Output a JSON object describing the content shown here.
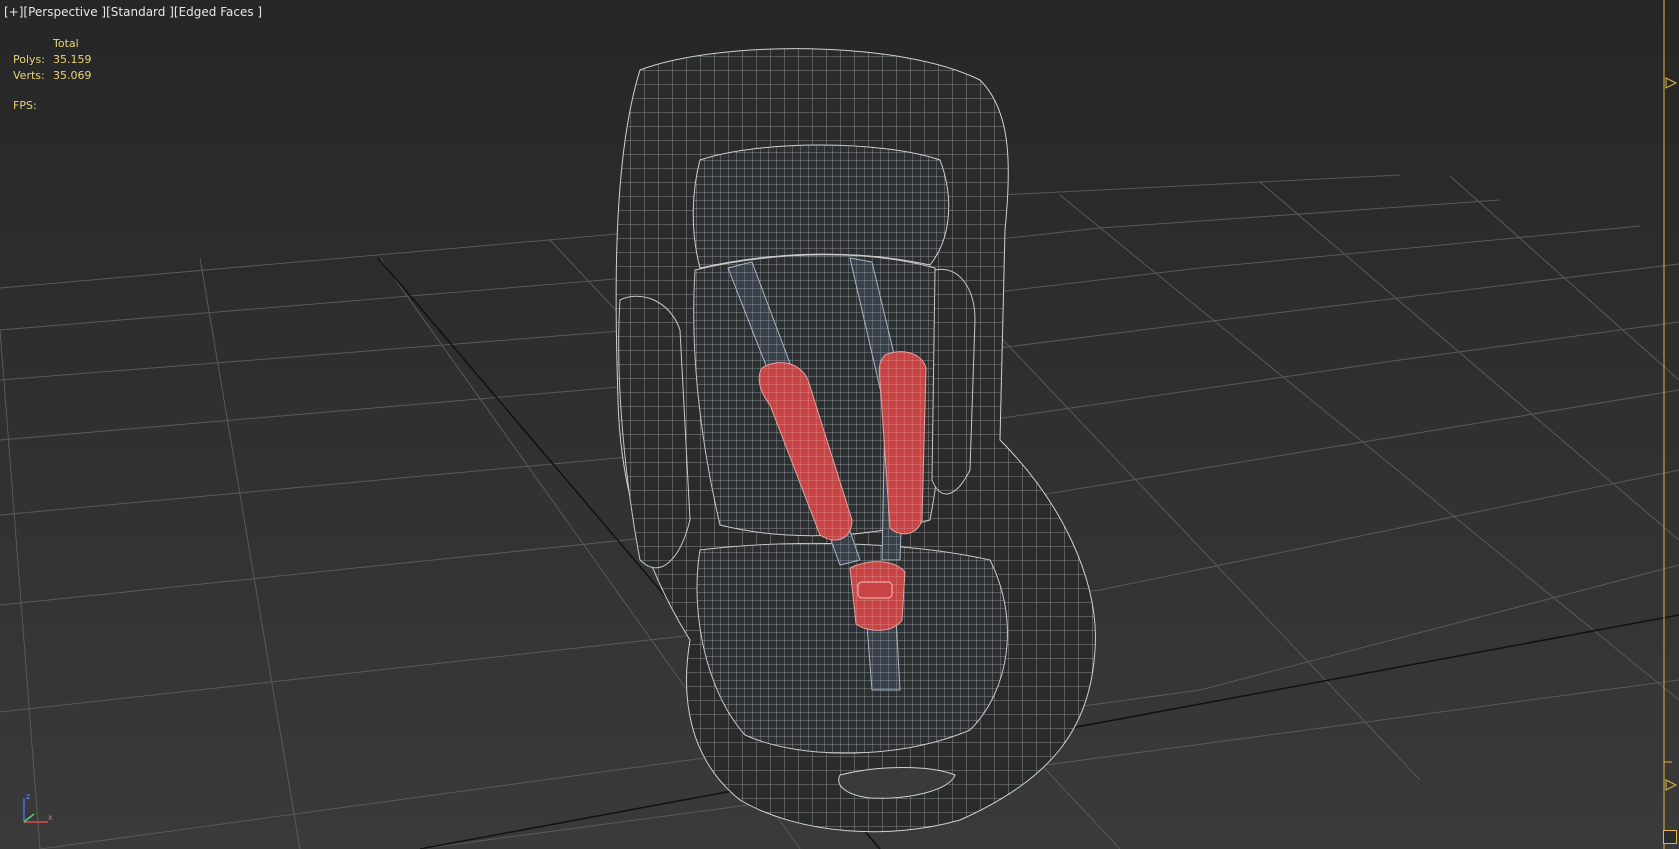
{
  "viewport": {
    "label_plus": "[+]",
    "label_view": "[Perspective ]",
    "label_shading": "[Standard ]",
    "label_mode": "[Edged Faces ]"
  },
  "stats": {
    "header": "Total",
    "polys_label": "Polys:",
    "polys_value": "35.159",
    "verts_label": "Verts:",
    "verts_value": "35.069",
    "fps_label": "FPS:"
  },
  "axis": {
    "z": "z",
    "x": "x"
  },
  "colors": {
    "background": "#2b2b2b",
    "grid": "#5a5a5a",
    "wire": "#c8c8c8",
    "seat": "#2a2c2c",
    "strap_pad": "#c94545",
    "stats_text": "#e9d27a",
    "track": "#e0b64a"
  },
  "object": {
    "name": "child car seat model",
    "icon": "wireframe-mesh"
  }
}
